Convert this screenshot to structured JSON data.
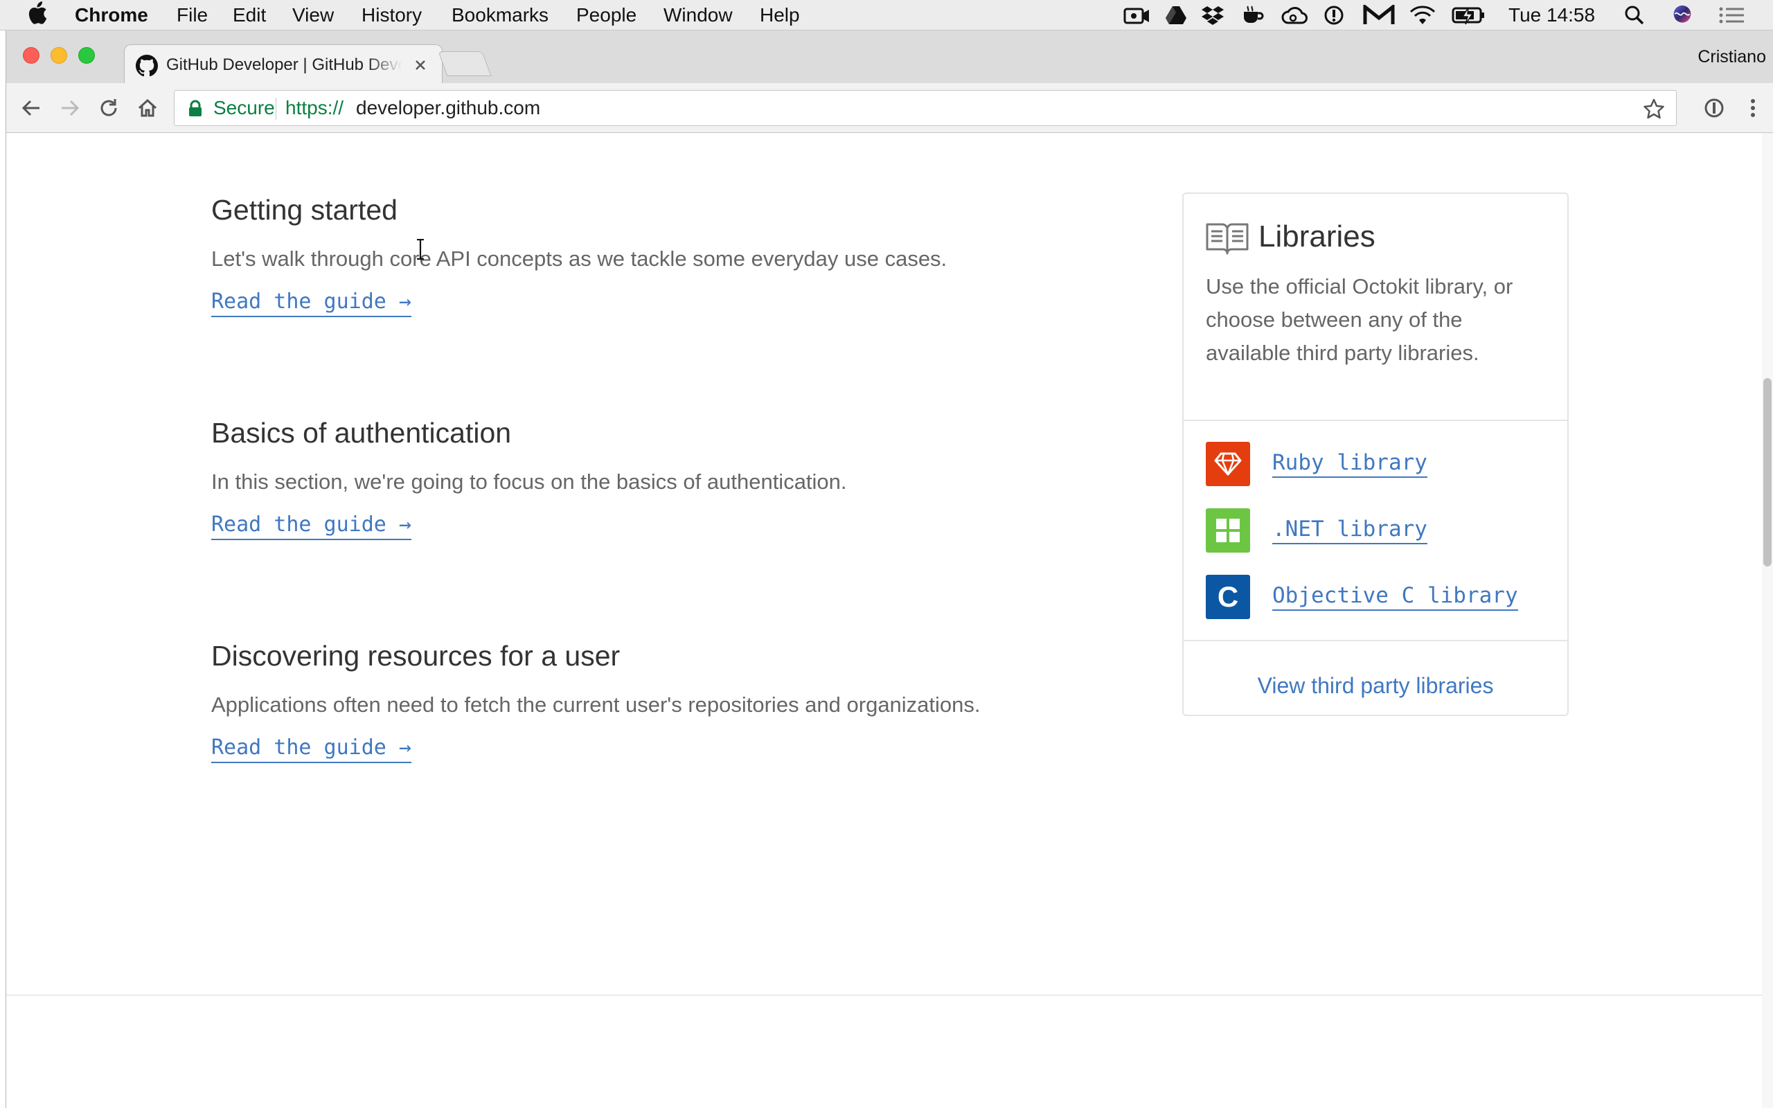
{
  "menubar": {
    "app_name": "Chrome",
    "items": [
      "File",
      "Edit",
      "View",
      "History",
      "Bookmarks",
      "People",
      "Window",
      "Help"
    ],
    "clock": "Tue 14:58",
    "tray_icons": [
      "camera-icon",
      "google-drive-icon",
      "dropbox-icon",
      "coffee-icon",
      "creative-cloud-icon",
      "info-circle-icon",
      "gmail-icon",
      "wifi-icon",
      "battery-icon",
      "spotlight-search-icon",
      "siri-icon",
      "notification-center-icon"
    ]
  },
  "browser": {
    "tab_title": "GitHub Developer | GitHub Developer Guide",
    "profile_name": "Cristiano",
    "secure_label": "Secure",
    "url_scheme": "https://",
    "url_host": "developer.github.com"
  },
  "sections": [
    {
      "title": "Getting started",
      "description": "Let's walk through core API concepts as we tackle some everyday use cases.",
      "link": "Read the guide →"
    },
    {
      "title": "Basics of authentication",
      "description": "In this section, we're going to focus on the basics of authentication.",
      "link": "Read the guide →"
    },
    {
      "title": "Discovering resources for a user",
      "description": "Applications often need to fetch the current user's repositories and organizations.",
      "link": "Read the guide →"
    }
  ],
  "libraries": {
    "title": "Libraries",
    "description": "Use the official Octokit library, or choose between any of the available third party libraries.",
    "items": [
      {
        "label": "Ruby library",
        "icon": "ruby-gem-icon",
        "color": "#e43e0f"
      },
      {
        "label": ".NET library",
        "icon": "windows-grid-icon",
        "color": "#6cc644"
      },
      {
        "label": "Objective C library",
        "icon": "objective-c-icon",
        "badge_letter": "C",
        "color": "#0b57a4"
      }
    ],
    "footer_link": "View third party libraries"
  },
  "colors": {
    "link": "#4078c0",
    "secure_green": "#0b8043"
  }
}
